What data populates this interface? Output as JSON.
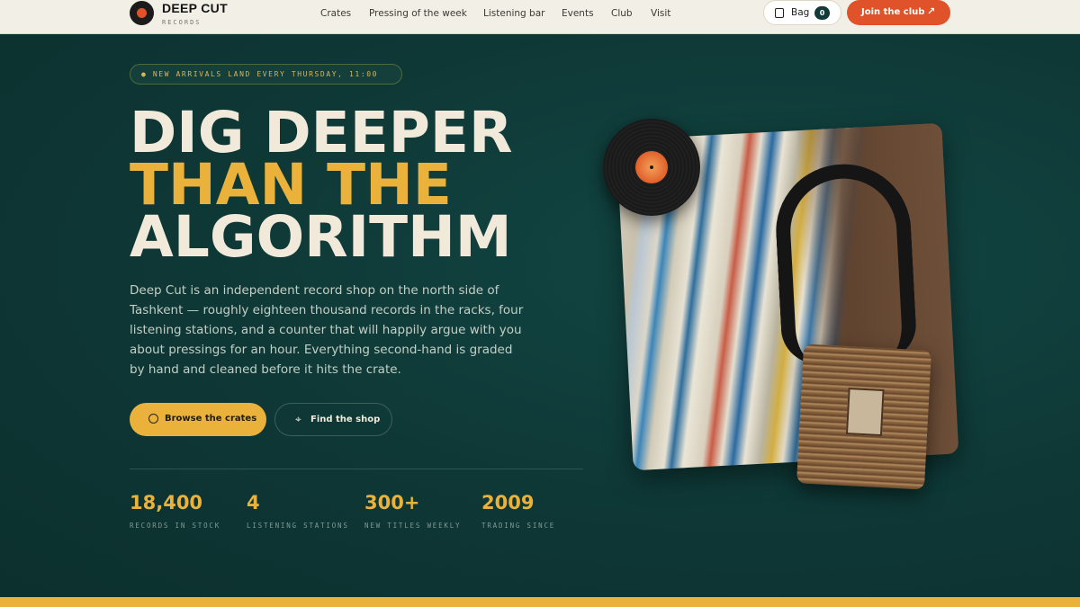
{
  "nav": {
    "brand_name": "DEEP CUT",
    "brand_sub": "RECORDS",
    "links": [
      "Crates",
      "Pressing of the week",
      "Listening bar",
      "Events",
      "Club",
      "Visit"
    ],
    "bag_label": "Bag",
    "bag_count": "0",
    "join_label": "Join the club",
    "join_arrow": "↗"
  },
  "hero": {
    "badge": "● NEW ARRIVALS LAND EVERY THURSDAY, 11:00",
    "headline_1": "DIG DEEPER",
    "headline_2": "THAN THE",
    "headline_3": "ALGORITHM",
    "intro": "Deep Cut is an independent record shop on the north side of Tashkent — roughly eighteen thousand records in the racks, four listening stations, and a counter that will happily argue with you about pressings for an hour. Everything second-hand is graded by hand and cleaned before it hits the crate.",
    "primary_label": "Browse the crates",
    "secondary_label": "Find the shop",
    "pin_icon": "⌖"
  },
  "stats": [
    {
      "value": "18,400",
      "label": "RECORDS IN STOCK"
    },
    {
      "value": "4",
      "label": "LISTENING STATIONS"
    },
    {
      "value": "300+",
      "label": "NEW TITLES WEEKLY"
    },
    {
      "value": "2009",
      "label": "TRADING SINCE"
    }
  ],
  "colors": {
    "accent_yellow": "#eab23a",
    "accent_orange": "#e0522a",
    "hero_bg": "#0f3a38",
    "cream": "#f1eadb"
  }
}
